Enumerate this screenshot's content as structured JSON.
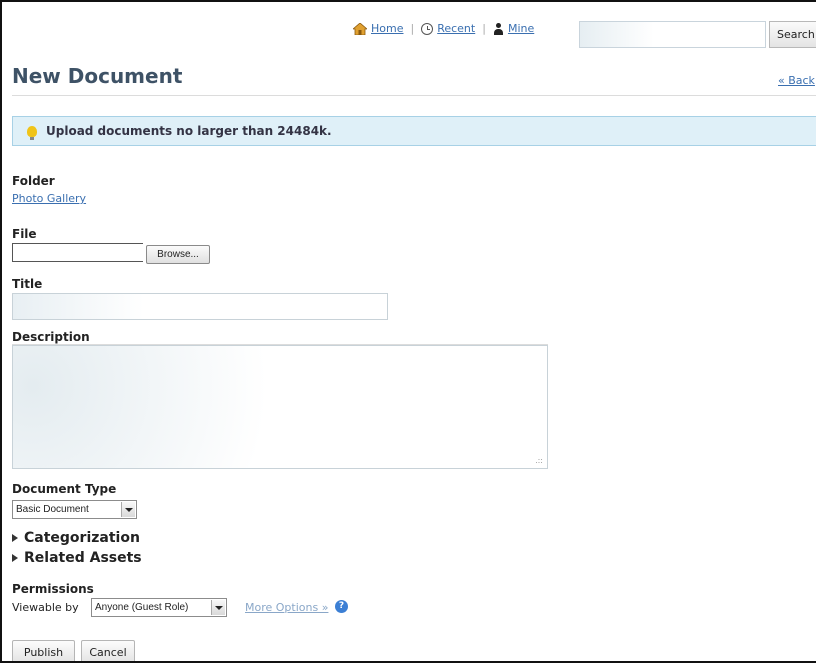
{
  "nav": {
    "home": "Home",
    "recent": "Recent",
    "mine": "Mine",
    "search_button": "Search",
    "search_value": ""
  },
  "page": {
    "title": "New Document",
    "back": "« Back"
  },
  "banner": {
    "text": "Upload documents no larger than 24484k."
  },
  "form": {
    "folder_label": "Folder",
    "folder_value": "Photo Gallery",
    "file_label": "File",
    "browse_button": "Browse...",
    "title_label": "Title",
    "title_value": "",
    "description_label": "Description",
    "description_value": "",
    "doctype_label": "Document Type",
    "doctype_value": "Basic Document",
    "categorization": "Categorization",
    "related_assets": "Related Assets",
    "permissions_label": "Permissions",
    "viewable_by": "Viewable by",
    "viewable_value": "Anyone (Guest Role)",
    "more_options": "More Options »",
    "help_glyph": "?"
  },
  "actions": {
    "publish": "Publish",
    "cancel": "Cancel"
  },
  "icons": {
    "home": "home-icon",
    "recent": "clock-icon",
    "mine": "user-icon",
    "tip": "lightbulb-icon",
    "help": "help-icon"
  },
  "colors": {
    "link": "#3a6fb0",
    "title": "#3e5266",
    "banner_bg": "#dff0f8",
    "banner_border": "#a7d1e6",
    "help": "#3c7fd4"
  }
}
